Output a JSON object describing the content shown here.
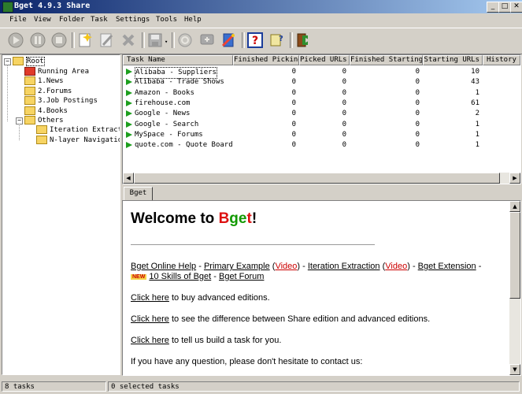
{
  "window": {
    "title": "Bget 4.9.3 Share"
  },
  "menu": [
    "File",
    "View",
    "Folder",
    "Task",
    "Settings",
    "Tools",
    "Help"
  ],
  "toolbar": {
    "buttons": [
      "start-icon",
      "pause-icon",
      "stop-icon",
      "new-task-icon",
      "edit-task-icon",
      "delete-task-icon",
      "save-icon",
      "browse-icon",
      "screen-icon",
      "wizard-icon",
      "help-icon",
      "about-icon",
      "exit-icon"
    ]
  },
  "tree": {
    "root": "Root",
    "running_area": "Running Area",
    "items": [
      "1.News",
      "2.Forums",
      "3.Job Postings",
      "4.Books",
      "Others",
      "Iteration Extractio",
      "N-layer Navigation"
    ]
  },
  "list": {
    "columns": [
      "Task Name",
      "Finished Picking",
      "Picked URLs",
      "Finished Starting",
      "Starting URLs",
      "History U"
    ],
    "rows": [
      {
        "name": "Alibaba - Suppliers",
        "finished_picking": "0",
        "picked_urls": "0",
        "finished_starting": "0",
        "starting_urls": "10"
      },
      {
        "name": "Alibaba - Trade Shows",
        "finished_picking": "0",
        "picked_urls": "0",
        "finished_starting": "0",
        "starting_urls": "43"
      },
      {
        "name": "Amazon - Books",
        "finished_picking": "0",
        "picked_urls": "0",
        "finished_starting": "0",
        "starting_urls": "1"
      },
      {
        "name": "firehouse.com",
        "finished_picking": "0",
        "picked_urls": "0",
        "finished_starting": "0",
        "starting_urls": "61"
      },
      {
        "name": "Google - News",
        "finished_picking": "0",
        "picked_urls": "0",
        "finished_starting": "0",
        "starting_urls": "2"
      },
      {
        "name": "Google - Search",
        "finished_picking": "0",
        "picked_urls": "0",
        "finished_starting": "0",
        "starting_urls": "1"
      },
      {
        "name": "MySpace - Forums",
        "finished_picking": "0",
        "picked_urls": "0",
        "finished_starting": "0",
        "starting_urls": "1"
      },
      {
        "name": "quote.com - Quote Board",
        "finished_picking": "0",
        "picked_urls": "0",
        "finished_starting": "0",
        "starting_urls": "1"
      }
    ]
  },
  "tab": {
    "label": "Bget"
  },
  "web": {
    "welcome_prefix": "Welcome to ",
    "brand_b": "B",
    "brand_ge": "ge",
    "brand_t": "t",
    "welcome_suffix": "!",
    "links": {
      "online_help": "Bget Online Help",
      "sep1": " - ",
      "primary_example": "Primary Example",
      "video": "Video",
      "iteration_extraction": "Iteration Extraction",
      "extension": "Bget Extension",
      "new_badge": "NEW",
      "ten_skills": "10 Skills of Bget",
      "forum": "Bget Forum"
    },
    "click_here": "Click here",
    "line1_rest": " to buy advanced editions.",
    "line2_rest": " to see the difference between Share edition and advanced editions.",
    "line3_rest": " to tell us build a task for you.",
    "line4": "If you have any question, please don't hesitate to contact us:"
  },
  "status": {
    "tasks": "8 tasks",
    "selected": "0 selected tasks"
  },
  "colors": {
    "titlebar_start": "#0a246a",
    "titlebar_end": "#a6caf0",
    "play_green": "#1d9e1d",
    "brand_red": "#d11",
    "brand_green": "#190"
  }
}
